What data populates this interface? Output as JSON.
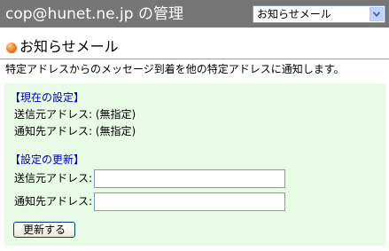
{
  "header": {
    "title": "cop@hunet.ne.jp の管理",
    "menu_select": {
      "selected": "お知らせメール"
    }
  },
  "page": {
    "title": "お知らせメール",
    "description": "特定アドレスからのメッセージ到着を他の特定アドレスに通知します。"
  },
  "current_settings": {
    "heading": "【現在の設定】",
    "sender_line": "送信元アドレス: (無指定)",
    "notify_line": "通知先アドレス: (無指定)"
  },
  "update_settings": {
    "heading": "【設定の更新】",
    "sender_label": "送信元アドレス:",
    "sender_value": "",
    "notify_label": "通知先アドレス:",
    "notify_value": "",
    "submit_label": "更新する"
  },
  "colors": {
    "header_bg": "#767676",
    "panel_bg": "#e8fbe4",
    "section_heading": "#0000aa"
  },
  "icons": [
    "bullet-icon",
    "chevron-down-icon"
  ]
}
